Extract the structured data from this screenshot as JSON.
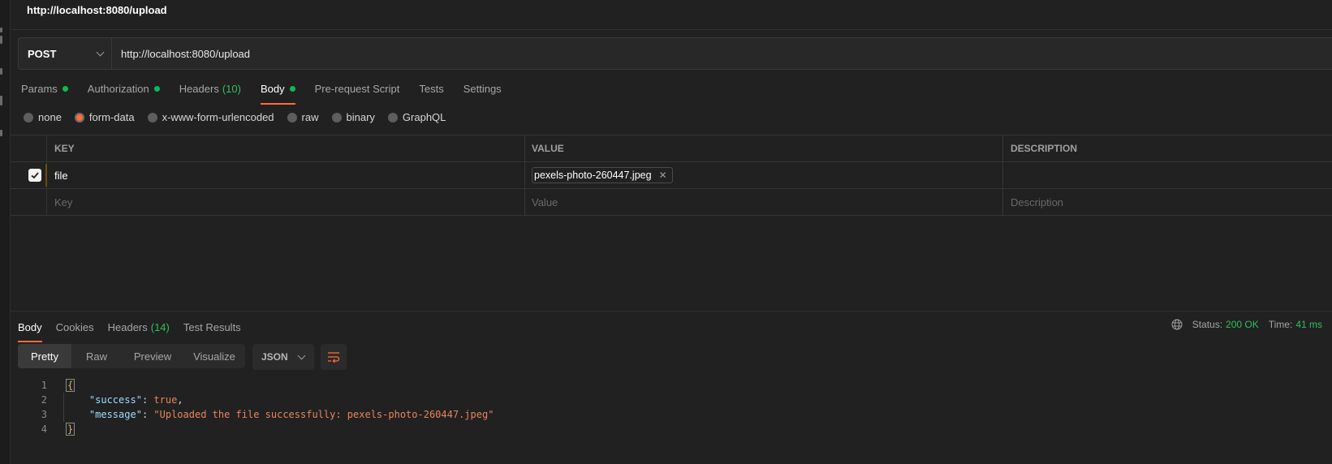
{
  "header": {
    "title": "http://localhost:8080/upload"
  },
  "request": {
    "method": "POST",
    "url": "http://localhost:8080/upload",
    "tabs": [
      {
        "label": "Params",
        "dot": true
      },
      {
        "label": "Authorization",
        "dot": true
      },
      {
        "label": "Headers",
        "count": "(10)"
      },
      {
        "label": "Body",
        "dot": true,
        "active": true
      },
      {
        "label": "Pre-request Script"
      },
      {
        "label": "Tests"
      },
      {
        "label": "Settings"
      }
    ],
    "body_types": [
      {
        "label": "none"
      },
      {
        "label": "form-data",
        "selected": true
      },
      {
        "label": "x-www-form-urlencoded"
      },
      {
        "label": "raw"
      },
      {
        "label": "binary"
      },
      {
        "label": "GraphQL"
      }
    ],
    "table": {
      "headers": {
        "key": "KEY",
        "value": "VALUE",
        "description": "DESCRIPTION"
      },
      "rows": [
        {
          "checked": true,
          "key": "file",
          "value": "pexels-photo-260447.jpeg",
          "description": ""
        }
      ],
      "placeholders": {
        "key": "Key",
        "value": "Value",
        "description": "Description"
      }
    }
  },
  "response": {
    "tabs": [
      {
        "label": "Body",
        "active": true
      },
      {
        "label": "Cookies"
      },
      {
        "label": "Headers",
        "count": "(14)"
      },
      {
        "label": "Test Results"
      }
    ],
    "status_label": "Status:",
    "status_value": "200 OK",
    "time_label": "Time:",
    "time_value": "41 ms",
    "views": [
      "Pretty",
      "Raw",
      "Preview",
      "Visualize"
    ],
    "active_view": "Pretty",
    "format": "JSON",
    "code": {
      "line_numbers": [
        "1",
        "2",
        "3",
        "4"
      ],
      "open_brace": "{",
      "close_brace": "}",
      "k1": "\"success\"",
      "v1": "true",
      "k2": "\"message\"",
      "v2": "\"Uploaded the file successfully: pexels-photo-260447.jpeg\""
    }
  },
  "colors": {
    "accent": "#ff6c37",
    "success": "#2fbf5f",
    "dot": "#0cbb52",
    "background": "#212121"
  }
}
